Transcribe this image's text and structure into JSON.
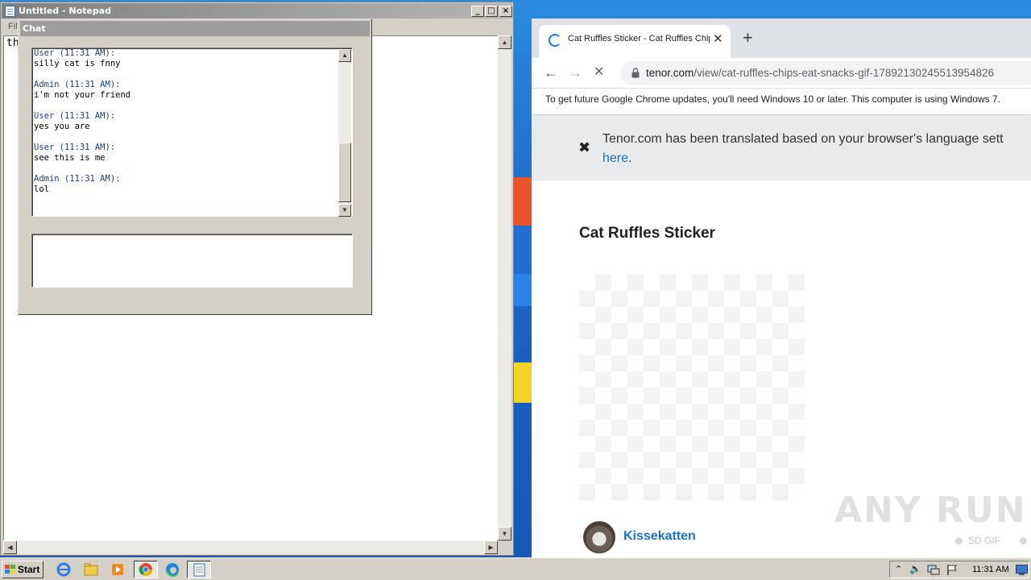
{
  "notepad": {
    "title": "Untitled - Notepad",
    "menu_first": "Fil",
    "content": "th",
    "minimize_glyph": "_",
    "maximize_glyph": "□",
    "close_glyph": "×"
  },
  "chat": {
    "title": "Chat",
    "messages": [
      {
        "head": "User (11:31 AM):",
        "body": "silly cat is fnny"
      },
      {
        "head": "Admin (11:31 AM):",
        "body": "i'm not your friend"
      },
      {
        "head": "User (11:31 AM):",
        "body": "yes you are"
      },
      {
        "head": "User (11:31 AM):",
        "body": "see this is me"
      },
      {
        "head": "Admin (11:31 AM):",
        "body": "lol"
      }
    ],
    "input_value": ""
  },
  "browser": {
    "tab_title": "Cat Ruffles Sticker - Cat Ruffles Chips",
    "url_host": "tenor.com",
    "url_path": "/view/cat-ruffles-chips-eat-snacks-gif-17892130245513954826",
    "update_notice": "To get future Google Chrome updates, you'll need Windows 10 or later. This computer is using Windows 7.",
    "translate_text": "Tenor.com has been translated based on your browser's language sett",
    "translate_link": "here",
    "translate_suffix": ".",
    "page_title": "Cat Ruffles Sticker",
    "author": "Kissekatten",
    "watermark": "ANY RUN",
    "sd_label": "SD GIF",
    "accent_color": "#1b72c5"
  },
  "taskbar": {
    "start_label": "Start",
    "clock": "11:31 AM",
    "pinned": [
      "ie-icon",
      "explorer-icon",
      "media-player-icon",
      "chrome-icon",
      "edge-icon",
      "notepad-icon"
    ]
  }
}
